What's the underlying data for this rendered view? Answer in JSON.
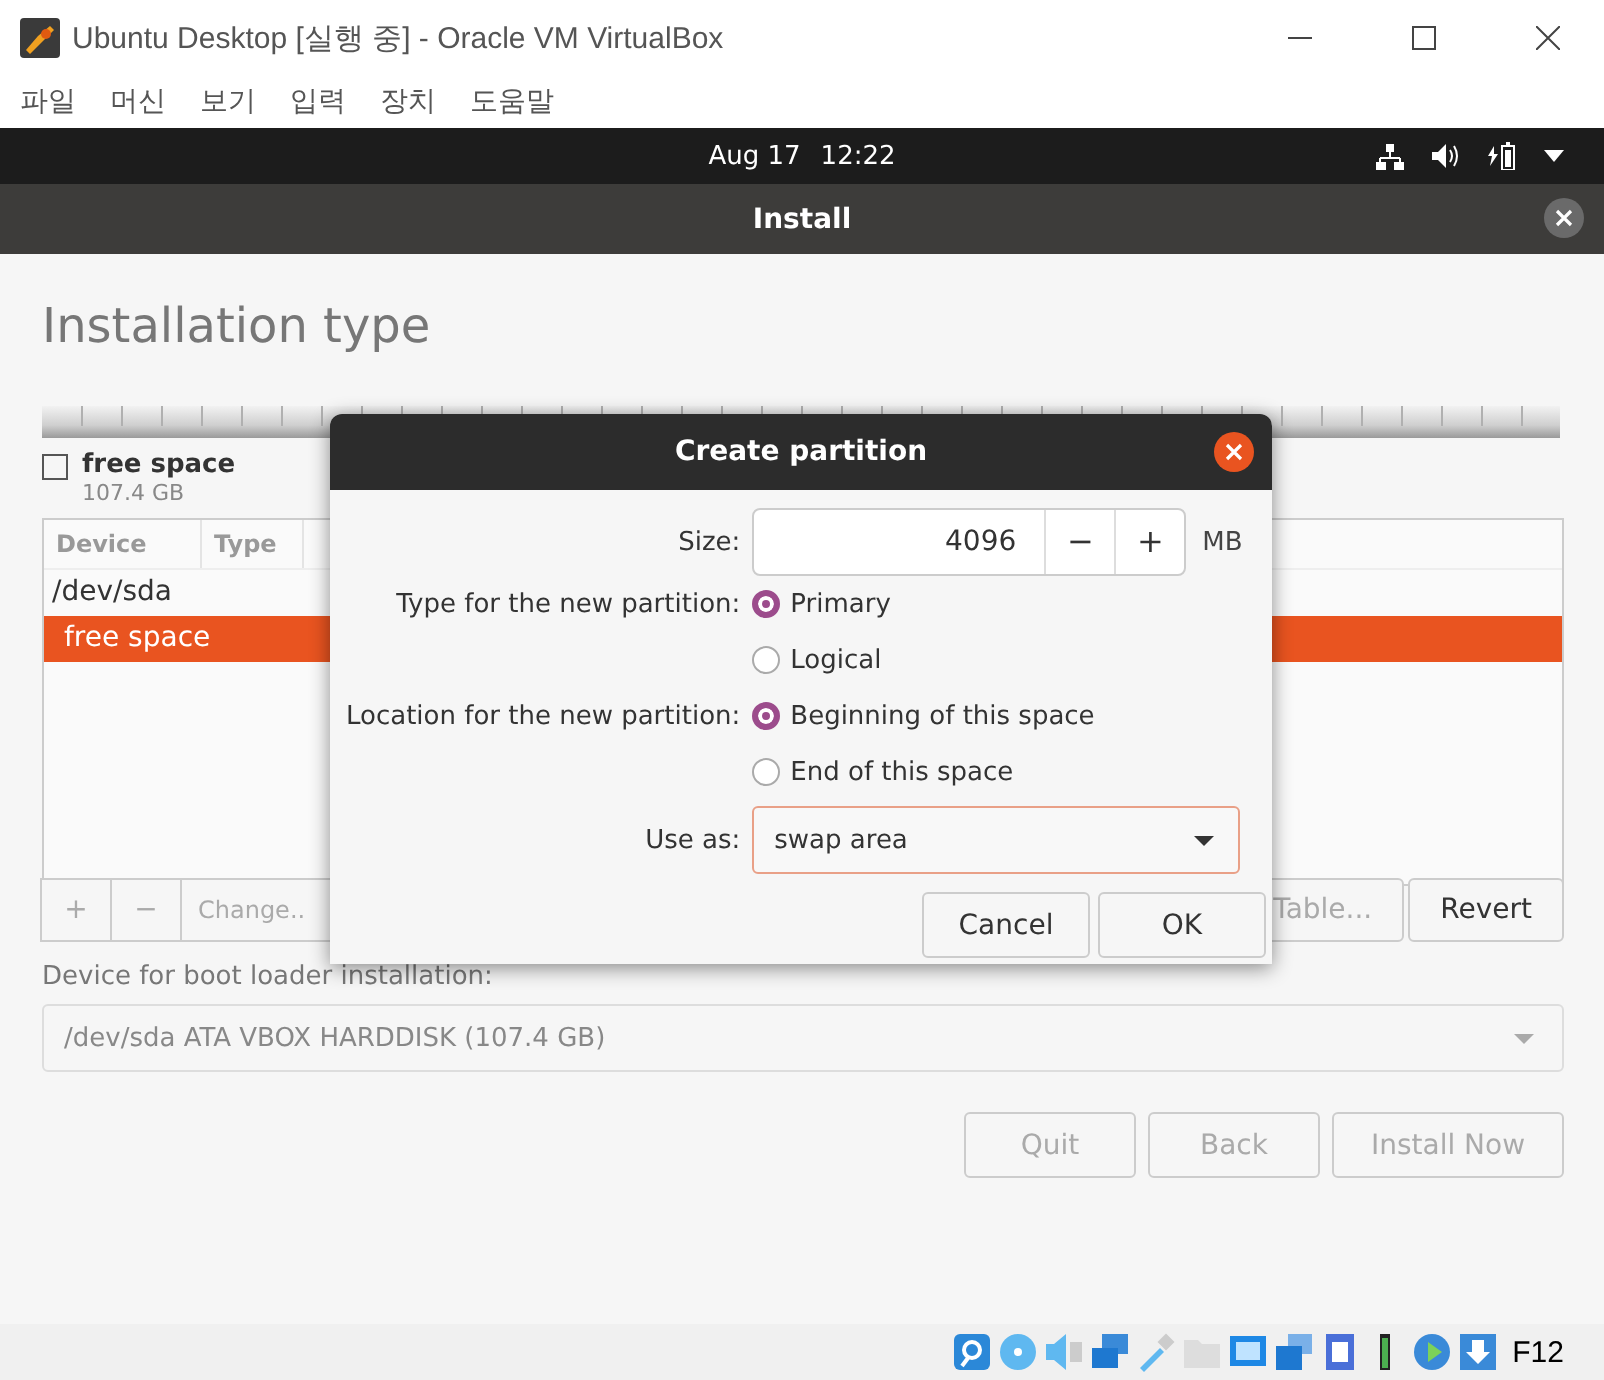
{
  "window": {
    "title": "Ubuntu Desktop [실행 중] - Oracle VM VirtualBox"
  },
  "menu": [
    "파일",
    "머신",
    "보기",
    "입력",
    "장치",
    "도움말"
  ],
  "top_bar": {
    "date": "Aug 17",
    "time": "12:22"
  },
  "header": {
    "title": "Install"
  },
  "page": {
    "title": "Installation type",
    "legend": {
      "label": "free space",
      "size": "107.4 GB",
      "checked": false
    },
    "table": {
      "columns": [
        "Device",
        "Type"
      ],
      "rows": [
        {
          "device": "/dev/sda",
          "selected": false,
          "children": [
            {
              "device": "free space",
              "selected": true
            }
          ]
        }
      ]
    },
    "table_buttons": [
      {
        "label": "+",
        "disabled": true
      },
      {
        "label": "−",
        "disabled": true
      },
      {
        "label": "Change..",
        "disabled": true
      }
    ],
    "right_buttons": [
      {
        "label": "Table...",
        "disabled": true
      },
      {
        "label": "Revert",
        "disabled": false
      }
    ],
    "boot_label": "Device for boot loader installation:",
    "boot_device": "/dev/sda ATA VBOX HARDDISK (107.4 GB)",
    "actions": [
      {
        "label": "Quit",
        "disabled": true
      },
      {
        "label": "Back",
        "disabled": true
      },
      {
        "label": "Install Now",
        "disabled": true
      }
    ]
  },
  "dialog": {
    "title": "Create partition",
    "size": {
      "label": "Size:",
      "value": "4096",
      "minus": "−",
      "plus": "+",
      "unit": "MB"
    },
    "type_label": "Type for the new partition:",
    "type_options": [
      {
        "label": "Primary",
        "selected": true
      },
      {
        "label": "Logical",
        "selected": false
      }
    ],
    "location_label": "Location for the new partition:",
    "location_options": [
      {
        "label": "Beginning of this space",
        "selected": true
      },
      {
        "label": "End of this space",
        "selected": false
      }
    ],
    "use_as": {
      "label": "Use as:",
      "value": "swap area"
    },
    "buttons": [
      {
        "label": "Cancel",
        "disabled": false
      },
      {
        "label": "OK",
        "disabled": false
      }
    ]
  },
  "status_bar": {
    "host_key": "F12"
  }
}
